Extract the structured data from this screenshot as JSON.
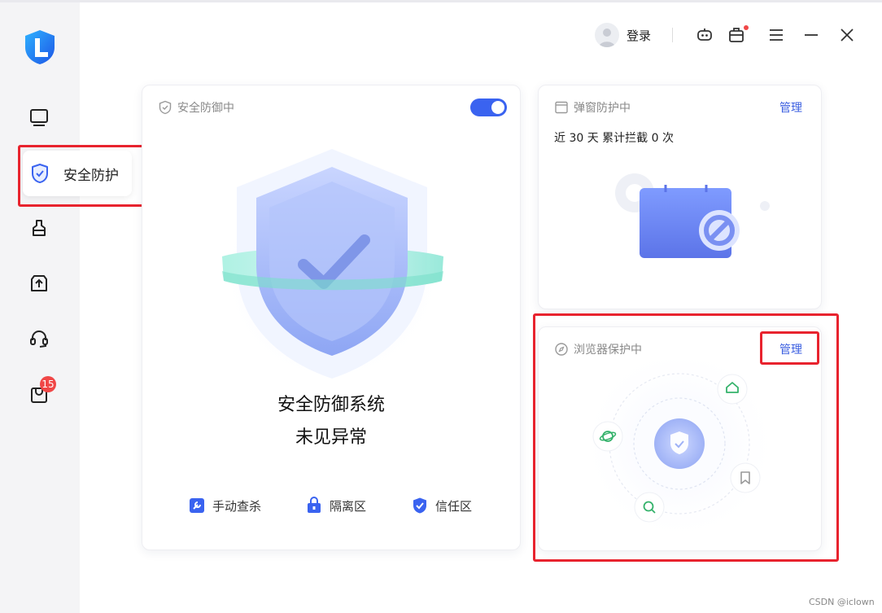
{
  "sidebar": {
    "active_label": "安全防护",
    "badge_count": "15",
    "items": [
      "monitor-icon",
      "shield-check-icon",
      "broom-icon",
      "box-upload-icon",
      "headset-icon",
      "bag-icon"
    ]
  },
  "header": {
    "login_label": "登录"
  },
  "defense_card": {
    "title": "安全防御中",
    "toggle_on": true,
    "status_line1": "安全防御系统",
    "status_line2": "未见异常",
    "actions": {
      "manual_scan": "手动查杀",
      "quarantine": "隔离区",
      "trust_zone": "信任区"
    }
  },
  "popup_card": {
    "title": "弹窗防护中",
    "manage": "管理",
    "stat": "近 30 天 累计拦截 0 次"
  },
  "browser_card": {
    "title": "浏览器保护中",
    "manage": "管理"
  },
  "watermark": "CSDN @iclown",
  "colors": {
    "accent": "#3a63f0",
    "highlight_box": "#e8232e",
    "badge": "#f04747",
    "browser_icon_green": "#35b26b"
  }
}
